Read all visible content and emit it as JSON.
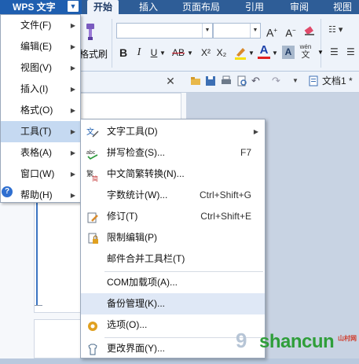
{
  "app": {
    "wps_button_label": "WPS 文字",
    "ribbon_tabs": [
      "开始",
      "插入",
      "页面布局",
      "引用",
      "审阅",
      "视图"
    ],
    "active_tab": "开始"
  },
  "ribbon": {
    "format_painter_label": "格式刷",
    "bold": "B",
    "italic": "I",
    "underline": "U",
    "strikethrough": "AB",
    "superscript": "X²",
    "subscript": "X₂",
    "font_color_letter": "A",
    "grow_font": "A⁺",
    "shrink_font": "A⁻"
  },
  "document": {
    "tab_title": "文档1 *"
  },
  "app_menu": {
    "items": [
      {
        "label": "文件(F)",
        "has_submenu": true
      },
      {
        "label": "编辑(E)",
        "has_submenu": true
      },
      {
        "label": "视图(V)",
        "has_submenu": true
      },
      {
        "label": "插入(I)",
        "has_submenu": true
      },
      {
        "label": "格式(O)",
        "has_submenu": true
      },
      {
        "label": "工具(T)",
        "has_submenu": true,
        "highlighted": true
      },
      {
        "label": "表格(A)",
        "has_submenu": true
      },
      {
        "label": "窗口(W)",
        "has_submenu": true
      },
      {
        "label": "帮助(H)",
        "has_submenu": true
      }
    ]
  },
  "tools_menu": {
    "items": [
      {
        "label": "文字工具(D)",
        "shortcut": "",
        "icon": "text-tools-icon",
        "has_submenu": true
      },
      {
        "label": "拼写检查(S)...",
        "shortcut": "F7",
        "icon": "spell-check-icon"
      },
      {
        "label": "中文简繁转换(N)...",
        "shortcut": "",
        "icon": "chinese-convert-icon"
      },
      {
        "label": "字数统计(W)...",
        "shortcut": "Ctrl+Shift+G",
        "icon": ""
      },
      {
        "label": "修订(T)",
        "shortcut": "Ctrl+Shift+E",
        "icon": "track-changes-icon"
      },
      {
        "label": "限制编辑(P)",
        "shortcut": "",
        "icon": "restrict-editing-icon"
      },
      {
        "label": "邮件合并工具栏(T)",
        "shortcut": "",
        "icon": ""
      },
      {
        "label": "COM加载项(A)...",
        "shortcut": "",
        "icon": ""
      },
      {
        "label": "备份管理(K)...",
        "shortcut": "",
        "icon": "",
        "highlighted": true
      },
      {
        "label": "选项(O)...",
        "shortcut": "",
        "icon": "options-gear-icon"
      },
      {
        "label": "更改界面(Y)...",
        "shortcut": "",
        "icon": "change-interface-icon"
      }
    ]
  },
  "watermark": {
    "text": "shancun",
    "small": "山村网"
  },
  "colors": {
    "tab_bar": "#2e5d97",
    "menu_highlight": "#c5d9f1",
    "submenu_highlight": "#dfe8f6",
    "ribbon_bg": "#eef3fa"
  }
}
